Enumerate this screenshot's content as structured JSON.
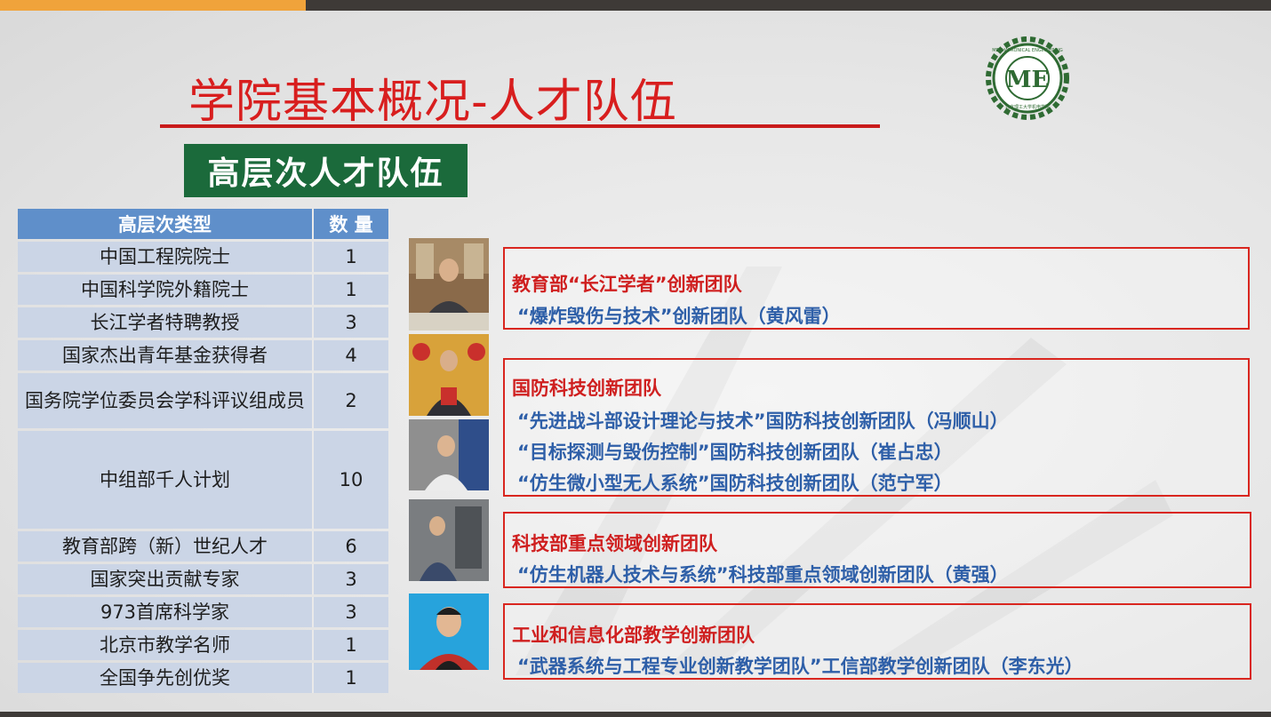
{
  "title": "学院基本概况-人才队伍",
  "subtitle": "高层次人才队伍",
  "logo": {
    "ring_text": "MECHATRONICAL ENGINEERING",
    "inner_text": "北京理工大学机电学院",
    "monogram": "ME",
    "color": "#2f6b33"
  },
  "table": {
    "headers": [
      "高层次类型",
      "数 量"
    ],
    "rows": [
      {
        "type": "中国工程院院士",
        "count": "1"
      },
      {
        "type": "中国科学院外籍院士",
        "count": "1"
      },
      {
        "type": "长江学者特聘教授",
        "count": "3"
      },
      {
        "type": "国家杰出青年基金获得者",
        "count": "4"
      },
      {
        "type": "国务院学位委员会学科评议组成员",
        "count": "2"
      },
      {
        "type": "中组部千人计划",
        "count": "10"
      },
      {
        "type": "教育部跨（新）世纪人才",
        "count": "6"
      },
      {
        "type": "国家突出贡献专家",
        "count": "3"
      },
      {
        "type": "973首席科学家",
        "count": "3"
      },
      {
        "type": "北京市教学名师",
        "count": "1"
      },
      {
        "type": "全国争先创优奖",
        "count": "1"
      }
    ]
  },
  "teams": [
    {
      "heading": "教育部“长江学者”创新团队",
      "lines": [
        "“爆炸毁伤与技术”创新团队（黄风雷）"
      ]
    },
    {
      "heading": "国防科技创新团队",
      "lines": [
        "“先进战斗部设计理论与技术”国防科技创新团队（冯顺山）",
        "“目标探测与毁伤控制”国防科技创新团队（崔占忠）",
        "“仿生微小型无人系统”国防科技创新团队（范宁军）"
      ]
    },
    {
      "heading": "科技部重点领域创新团队",
      "lines": [
        "“仿生机器人技术与系统”科技部重点领域创新团队（黄强）"
      ]
    },
    {
      "heading": "工业和信息化部教学创新团队",
      "lines": [
        "“武器系统与工程专业创新教学团队”工信部教学创新团队（李东光）"
      ]
    }
  ],
  "colors": {
    "title_red": "#d81e1e",
    "banner_green": "#1b6a3b",
    "table_header": "#5f8fca",
    "table_cell": "#cbd5e6",
    "team_heading": "#cf1f1f",
    "team_text": "#2e5fa8",
    "accent_orange": "#f0a33b",
    "bar_dark": "#3e3a37"
  }
}
